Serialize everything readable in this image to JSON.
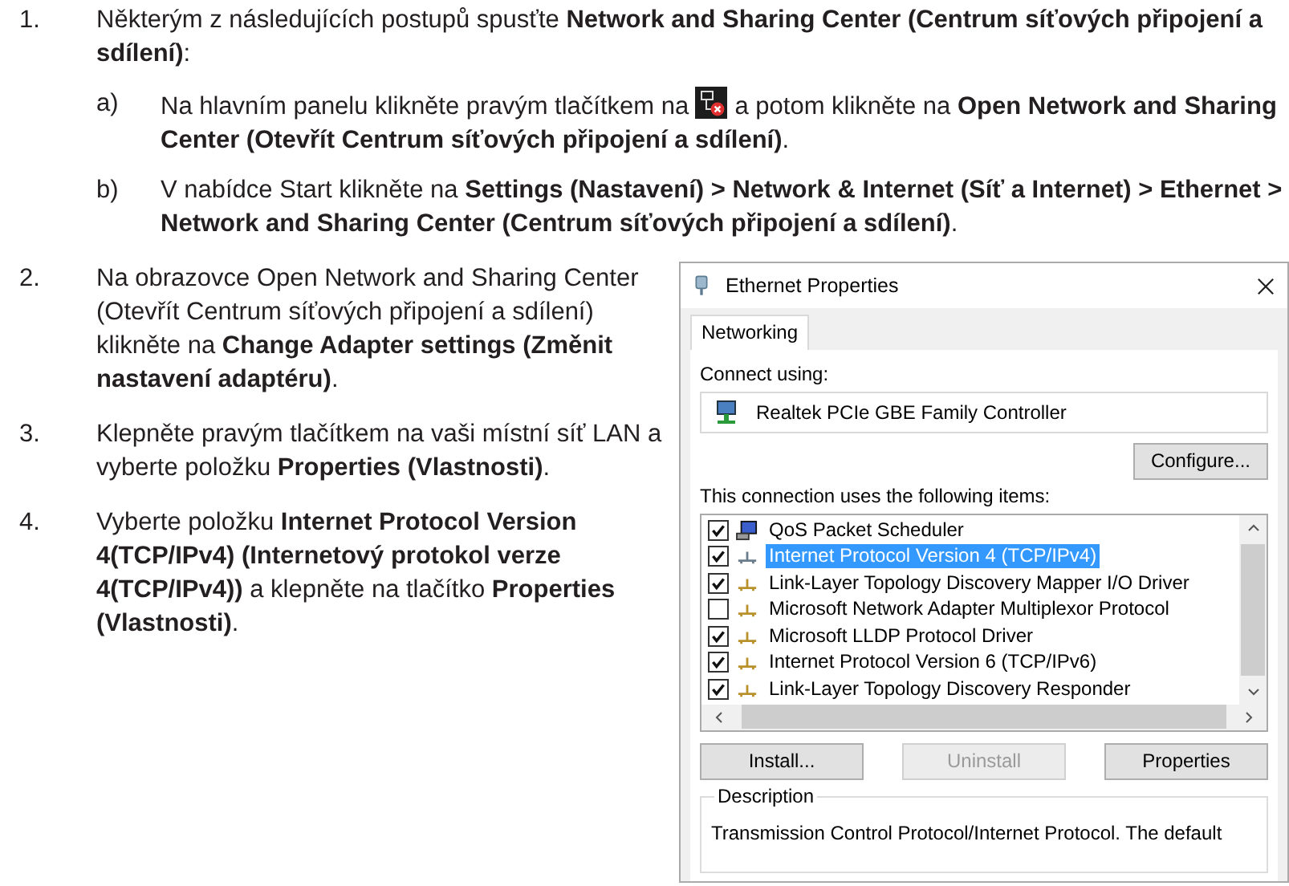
{
  "steps": [
    {
      "number": "1.",
      "text": "Některým z následujících postupů spusťte **Network and Sharing Center (Centrum síťových připojení a sdílení)**:",
      "substeps": [
        {
          "letter": "a)",
          "text_before": "Na hlavním panelu klikněte pravým tlačítkem na",
          "text_after": "a potom klikněte na **Open Network and Sharing Center (Otevřít Centrum síťových připojení a sdílení)**."
        },
        {
          "letter": "b)",
          "text": "V nabídce Start klikněte na **Settings (Nastavení) > Network & Internet (Síť a Internet) > Ethernet > Network and Sharing Center (Centrum síťových připojení a sdílení)**."
        }
      ]
    },
    {
      "number": "2.",
      "text": "Na obrazovce Open Network and Sharing Center (Otevřít Centrum síťových připojení a sdílení) klikněte na **Change Adapter settings (Změnit nastavení adaptéru)**."
    },
    {
      "number": "3.",
      "text": "Klepněte pravým tlačítkem na vaši místní síť LAN a vyberte položku **Properties (Vlastnosti)**."
    },
    {
      "number": "4.",
      "text": "Vyberte položku **Internet Protocol Version 4(TCP/IPv4) (Internetový protokol verze 4(TCP/IPv4))** a klepněte na tlačítko **Properties (Vlastnosti)**."
    }
  ],
  "dialog": {
    "title": "Ethernet Properties",
    "tabs": [
      {
        "label": "Networking",
        "selected": true
      }
    ],
    "connect_using_label": "Connect using:",
    "adapter": "Realtek PCIe GBE Family Controller",
    "configure_button": "Configure...",
    "items_label": "This connection uses the following items:",
    "items": [
      {
        "label": "QoS Packet Scheduler",
        "kind": "service",
        "checked": true,
        "selected": false
      },
      {
        "label": "Internet Protocol Version 4 (TCP/IPv4)",
        "kind": "protocol",
        "checked": true,
        "selected": true
      },
      {
        "label": "Link-Layer Topology Discovery Mapper I/O Driver",
        "kind": "protocol",
        "checked": true,
        "selected": false
      },
      {
        "label": "Microsoft Network Adapter Multiplexor Protocol",
        "kind": "protocol",
        "checked": false,
        "selected": false
      },
      {
        "label": "Microsoft LLDP Protocol Driver",
        "kind": "protocol",
        "checked": true,
        "selected": false
      },
      {
        "label": "Internet Protocol Version 6 (TCP/IPv6)",
        "kind": "protocol",
        "checked": true,
        "selected": false
      },
      {
        "label": "Link-Layer Topology Discovery Responder",
        "kind": "protocol",
        "checked": true,
        "selected": false
      }
    ],
    "buttons": [
      {
        "label": "Install...",
        "disabled": false
      },
      {
        "label": "Uninstall",
        "disabled": true
      },
      {
        "label": "Properties",
        "disabled": false
      }
    ],
    "description_label": "Description",
    "description_text": "Transmission Control Protocol/Internet Protocol. The default"
  }
}
